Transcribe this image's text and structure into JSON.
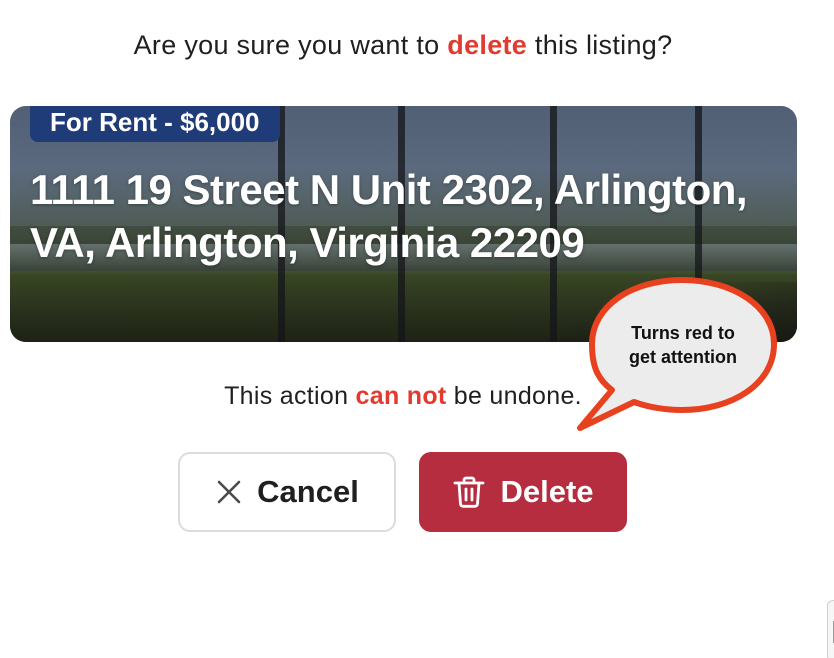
{
  "dialog": {
    "question_before": "Are you sure you want to ",
    "question_accent": "delete",
    "question_after": " this listing?",
    "warning_before": "This action ",
    "warning_accent": "can not",
    "warning_after": " be undone.",
    "accent_color": "#e23a2e"
  },
  "listing": {
    "price_badge": "For Rent - $6,000",
    "address": "1111 19 Street N Unit 2302, Arlington, VA, Arlington, Virginia 22209",
    "badge_color": "#1f3b78"
  },
  "buttons": {
    "cancel": {
      "label": "Cancel",
      "icon": "close-icon"
    },
    "delete": {
      "label": "Delete",
      "icon": "trash-icon",
      "color": "#b52d3f"
    }
  },
  "callout": {
    "text_line1": "Turns red to",
    "text_line2": "get attention",
    "border_color": "#e8411f",
    "fill_color": "#ececec"
  }
}
